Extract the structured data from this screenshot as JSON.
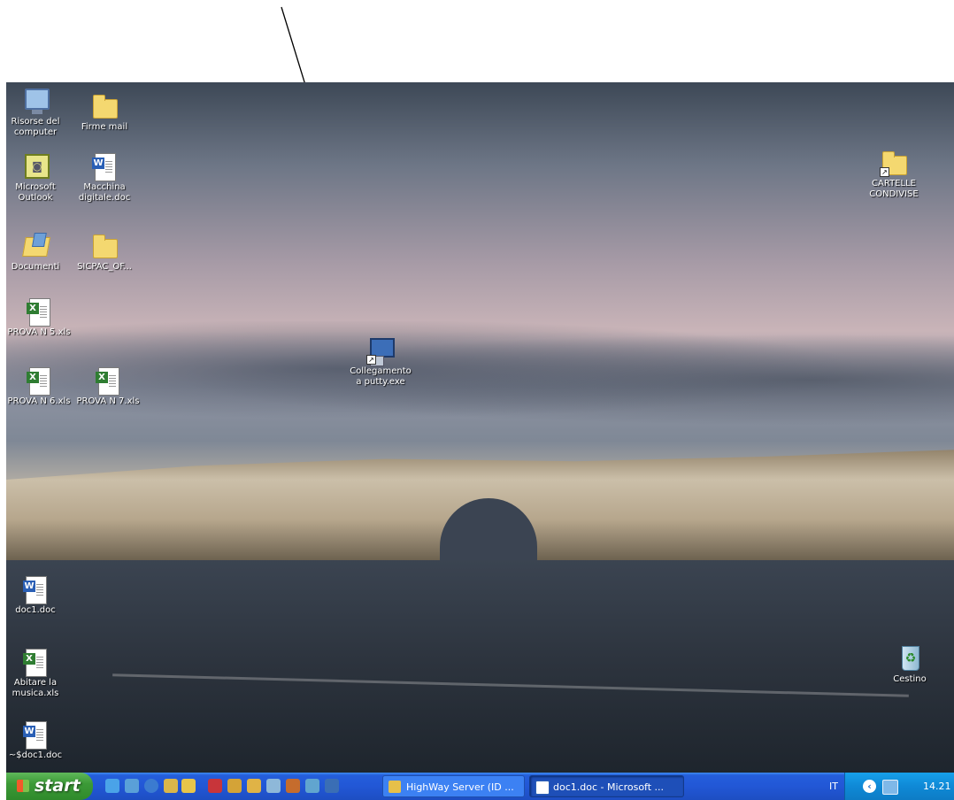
{
  "desktop_icons": {
    "risorse": {
      "label": "Risorse del computer"
    },
    "firme": {
      "label": "Firme mail"
    },
    "outlook": {
      "label": "Microsoft Outlook"
    },
    "macchina": {
      "label": "Macchina digitale.doc"
    },
    "documenti": {
      "label": "Documenti"
    },
    "sicpac": {
      "label": "SICPAC_OF..."
    },
    "prova5": {
      "label": "PROVA N 5.xls"
    },
    "prova6": {
      "label": "PROVA N 6.xls"
    },
    "prova7": {
      "label": "PROVA N 7.xls"
    },
    "putty": {
      "label": "Collegamento a putty.exe"
    },
    "cartelle": {
      "label": "CARTELLE CONDIVISE"
    },
    "doc1": {
      "label": "doc1.doc"
    },
    "abitare": {
      "label": "Abitare la musica.xls"
    },
    "tempdoc": {
      "label": "~$doc1.doc"
    },
    "cestino": {
      "label": "Cestino"
    }
  },
  "taskbar": {
    "start_label": "start",
    "tasks": [
      {
        "label": "HighWay Server (ID ..."
      },
      {
        "label": "doc1.doc - Microsoft ..."
      }
    ],
    "language": "IT",
    "clock": "14.21"
  },
  "colors": {
    "taskbar_blue": "#245edb",
    "start_green": "#3c9a37",
    "tray_blue": "#0f89d6"
  }
}
